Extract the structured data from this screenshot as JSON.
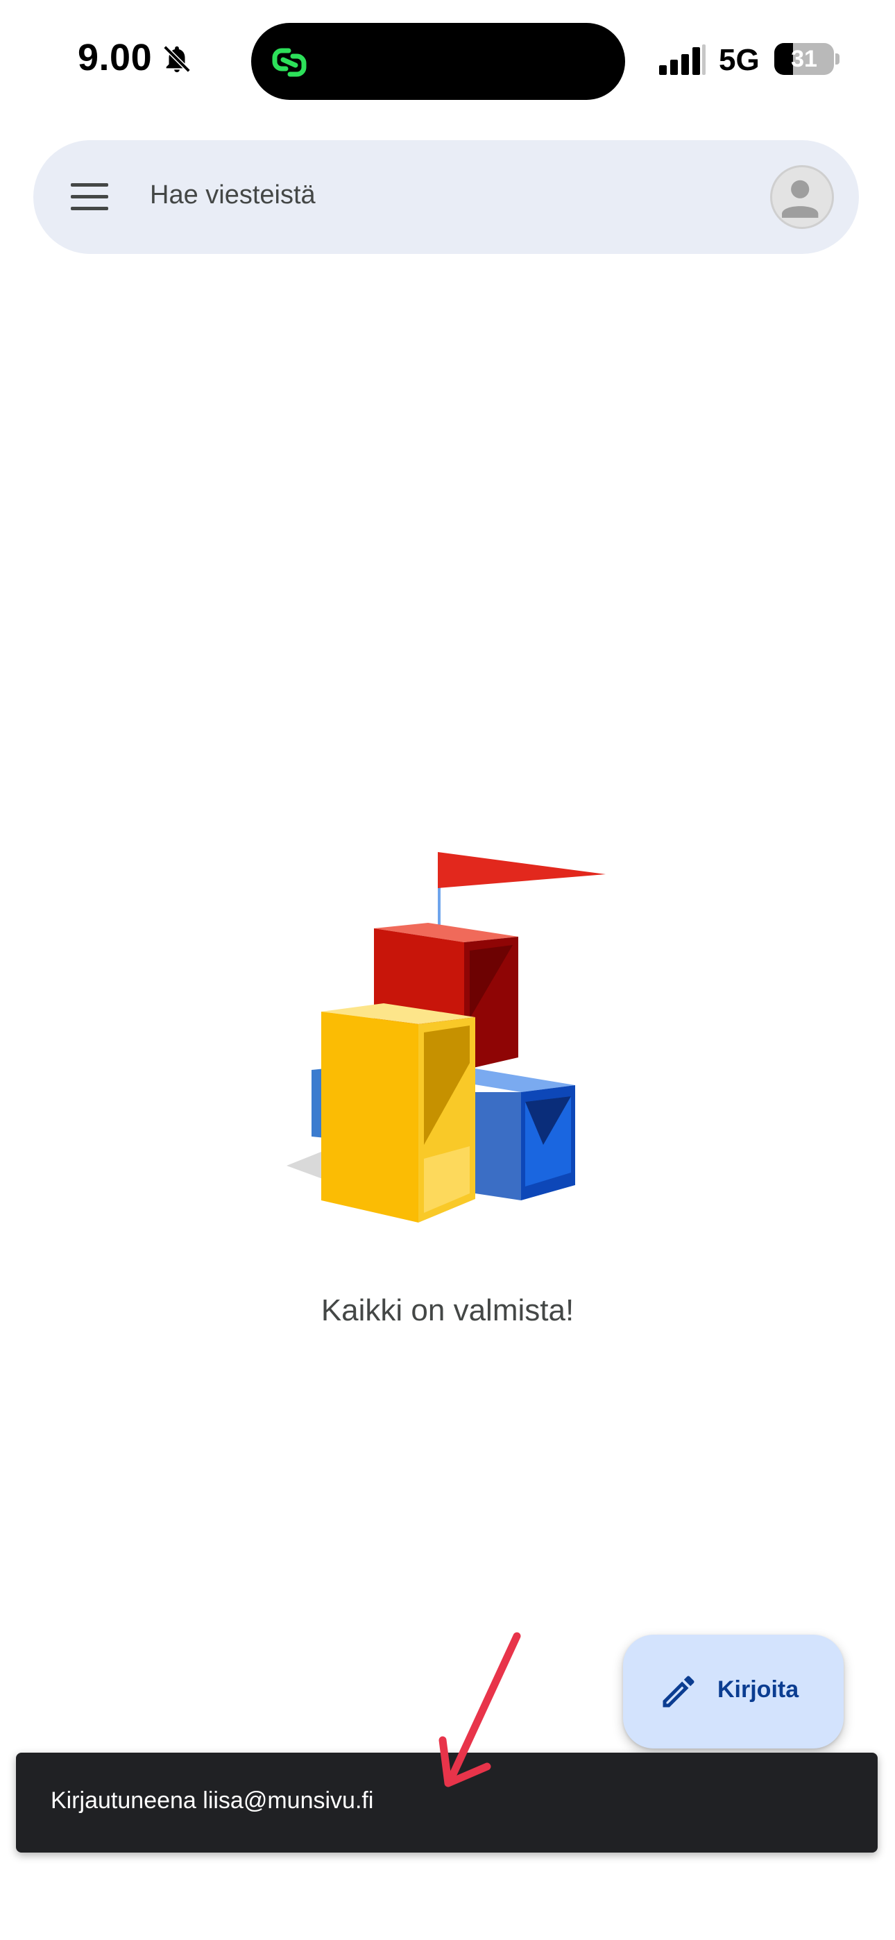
{
  "status_bar": {
    "time": "9.00",
    "network": "5G",
    "battery_level": "31",
    "battery_fraction": 0.31,
    "icons": [
      "bell-muted-icon",
      "signal-icon",
      "battery-icon",
      "island-app-icon"
    ]
  },
  "search": {
    "placeholder": "Hae viesteistä",
    "icons": [
      "menu-icon",
      "avatar"
    ]
  },
  "empty_state": {
    "message": "Kaikki on valmista!",
    "illustration": "blocks-with-flag-illustration"
  },
  "compose": {
    "label": "Kirjoita",
    "icon": "pencil-icon"
  },
  "snackbar": {
    "text": "Kirjautuneena liisa@munsivu.fi"
  },
  "colors": {
    "search_bg": "#e9edf6",
    "fab_bg": "#d3e3fd",
    "fab_text": "#0b3d91",
    "snackbar_bg": "#202124",
    "annotation_arrow": "#e8344a",
    "island_icon_green": "#2de05a"
  }
}
